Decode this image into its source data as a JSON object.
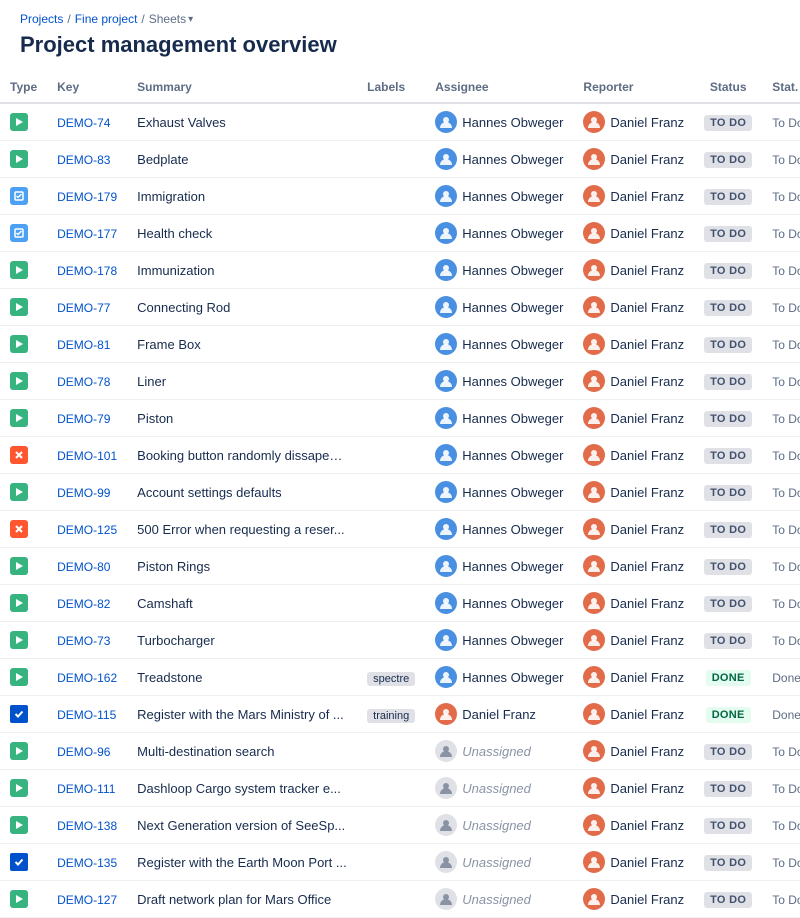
{
  "breadcrumb": {
    "items": [
      "Projects",
      "Fine project",
      "Sheets"
    ]
  },
  "page": {
    "title": "Project management overview"
  },
  "table": {
    "columns": [
      "Type",
      "Key",
      "Summary",
      "Labels",
      "Assignee",
      "Reporter",
      "Status",
      "Stat."
    ],
    "rows": [
      {
        "type": "story",
        "key": "DEMO-74",
        "summary": "Exhaust Valves",
        "labels": "",
        "assignee": "Hannes Obweger",
        "assignee_type": "ho",
        "reporter": "Daniel Franz",
        "reporter_type": "df",
        "status": "TO DO",
        "status_class": "todo",
        "stat2": "To Do"
      },
      {
        "type": "story",
        "key": "DEMO-83",
        "summary": "Bedplate",
        "labels": "",
        "assignee": "Hannes Obweger",
        "assignee_type": "ho",
        "reporter": "Daniel Franz",
        "reporter_type": "df",
        "status": "TO DO",
        "status_class": "todo",
        "stat2": "To Do"
      },
      {
        "type": "task",
        "key": "DEMO-179",
        "summary": "Immigration",
        "labels": "",
        "assignee": "Hannes Obweger",
        "assignee_type": "ho",
        "reporter": "Daniel Franz",
        "reporter_type": "df",
        "status": "TO DO",
        "status_class": "todo",
        "stat2": "To Do"
      },
      {
        "type": "task",
        "key": "DEMO-177",
        "summary": "Health check",
        "labels": "",
        "assignee": "Hannes Obweger",
        "assignee_type": "ho",
        "reporter": "Daniel Franz",
        "reporter_type": "df",
        "status": "TO DO",
        "status_class": "todo",
        "stat2": "To Do"
      },
      {
        "type": "story",
        "key": "DEMO-178",
        "summary": "Immunization",
        "labels": "",
        "assignee": "Hannes Obweger",
        "assignee_type": "ho",
        "reporter": "Daniel Franz",
        "reporter_type": "df",
        "status": "TO DO",
        "status_class": "todo",
        "stat2": "To Do"
      },
      {
        "type": "story",
        "key": "DEMO-77",
        "summary": "Connecting Rod",
        "labels": "",
        "assignee": "Hannes Obweger",
        "assignee_type": "ho",
        "reporter": "Daniel Franz",
        "reporter_type": "df",
        "status": "TO DO",
        "status_class": "todo",
        "stat2": "To Do"
      },
      {
        "type": "story",
        "key": "DEMO-81",
        "summary": "Frame Box",
        "labels": "",
        "assignee": "Hannes Obweger",
        "assignee_type": "ho",
        "reporter": "Daniel Franz",
        "reporter_type": "df",
        "status": "TO DO",
        "status_class": "todo",
        "stat2": "To Do"
      },
      {
        "type": "story",
        "key": "DEMO-78",
        "summary": "Liner",
        "labels": "",
        "assignee": "Hannes Obweger",
        "assignee_type": "ho",
        "reporter": "Daniel Franz",
        "reporter_type": "df",
        "status": "TO DO",
        "status_class": "todo",
        "stat2": "To Do"
      },
      {
        "type": "story",
        "key": "DEMO-79",
        "summary": "Piston",
        "labels": "",
        "assignee": "Hannes Obweger",
        "assignee_type": "ho",
        "reporter": "Daniel Franz",
        "reporter_type": "df",
        "status": "TO DO",
        "status_class": "todo",
        "stat2": "To Do"
      },
      {
        "type": "bug",
        "key": "DEMO-101",
        "summary": "Booking button randomly dissapea...",
        "labels": "",
        "assignee": "Hannes Obweger",
        "assignee_type": "ho",
        "reporter": "Daniel Franz",
        "reporter_type": "df",
        "status": "TO DO",
        "status_class": "todo",
        "stat2": "To Do"
      },
      {
        "type": "story",
        "key": "DEMO-99",
        "summary": "Account settings defaults",
        "labels": "",
        "assignee": "Hannes Obweger",
        "assignee_type": "ho",
        "reporter": "Daniel Franz",
        "reporter_type": "df",
        "status": "TO DO",
        "status_class": "todo",
        "stat2": "To Do"
      },
      {
        "type": "bug",
        "key": "DEMO-125",
        "summary": "500 Error when requesting a reser...",
        "labels": "",
        "assignee": "Hannes Obweger",
        "assignee_type": "ho",
        "reporter": "Daniel Franz",
        "reporter_type": "df",
        "status": "TO DO",
        "status_class": "todo",
        "stat2": "To Do"
      },
      {
        "type": "story",
        "key": "DEMO-80",
        "summary": "Piston Rings",
        "labels": "",
        "assignee": "Hannes Obweger",
        "assignee_type": "ho",
        "reporter": "Daniel Franz",
        "reporter_type": "df",
        "status": "TO DO",
        "status_class": "todo",
        "stat2": "To Do"
      },
      {
        "type": "story",
        "key": "DEMO-82",
        "summary": "Camshaft",
        "labels": "",
        "assignee": "Hannes Obweger",
        "assignee_type": "ho",
        "reporter": "Daniel Franz",
        "reporter_type": "df",
        "status": "TO DO",
        "status_class": "todo",
        "stat2": "To Do"
      },
      {
        "type": "story",
        "key": "DEMO-73",
        "summary": "Turbocharger",
        "labels": "",
        "assignee": "Hannes Obweger",
        "assignee_type": "ho",
        "reporter": "Daniel Franz",
        "reporter_type": "df",
        "status": "TO DO",
        "status_class": "todo",
        "stat2": "To Do"
      },
      {
        "type": "story",
        "key": "DEMO-162",
        "summary": "Treadstone",
        "labels": "spectre",
        "assignee": "Hannes Obweger",
        "assignee_type": "ho",
        "reporter": "Daniel Franz",
        "reporter_type": "df",
        "status": "DONE",
        "status_class": "done",
        "stat2": "Done"
      },
      {
        "type": "checkbox",
        "key": "DEMO-115",
        "summary": "Register with the Mars Ministry of ...",
        "labels": "training",
        "assignee": "Daniel Franz",
        "assignee_type": "df",
        "reporter": "Daniel Franz",
        "reporter_type": "df",
        "status": "DONE",
        "status_class": "done",
        "stat2": "Done"
      },
      {
        "type": "story",
        "key": "DEMO-96",
        "summary": "Multi-destination search",
        "labels": "",
        "assignee": "Unassigned",
        "assignee_type": "un",
        "reporter": "Daniel Franz",
        "reporter_type": "df",
        "status": "TO DO",
        "status_class": "todo",
        "stat2": "To Do"
      },
      {
        "type": "story",
        "key": "DEMO-111",
        "summary": "Dashloop Cargo system tracker e...",
        "labels": "",
        "assignee": "Unassigned",
        "assignee_type": "un",
        "reporter": "Daniel Franz",
        "reporter_type": "df",
        "status": "TO DO",
        "status_class": "todo",
        "stat2": "To Do"
      },
      {
        "type": "story",
        "key": "DEMO-138",
        "summary": "Next Generation version of SeeSp...",
        "labels": "",
        "assignee": "Unassigned",
        "assignee_type": "un",
        "reporter": "Daniel Franz",
        "reporter_type": "df",
        "status": "TO DO",
        "status_class": "todo",
        "stat2": "To Do"
      },
      {
        "type": "checkbox",
        "key": "DEMO-135",
        "summary": "Register with the Earth Moon Port ...",
        "labels": "",
        "assignee": "Unassigned",
        "assignee_type": "un",
        "reporter": "Daniel Franz",
        "reporter_type": "df",
        "status": "TO DO",
        "status_class": "todo",
        "stat2": "To Do"
      },
      {
        "type": "story",
        "key": "DEMO-127",
        "summary": "Draft network plan for Mars Office",
        "labels": "",
        "assignee": "Unassigned",
        "assignee_type": "un",
        "reporter": "Daniel Franz",
        "reporter_type": "df",
        "status": "TO DO",
        "status_class": "todo",
        "stat2": "To Do"
      }
    ]
  }
}
